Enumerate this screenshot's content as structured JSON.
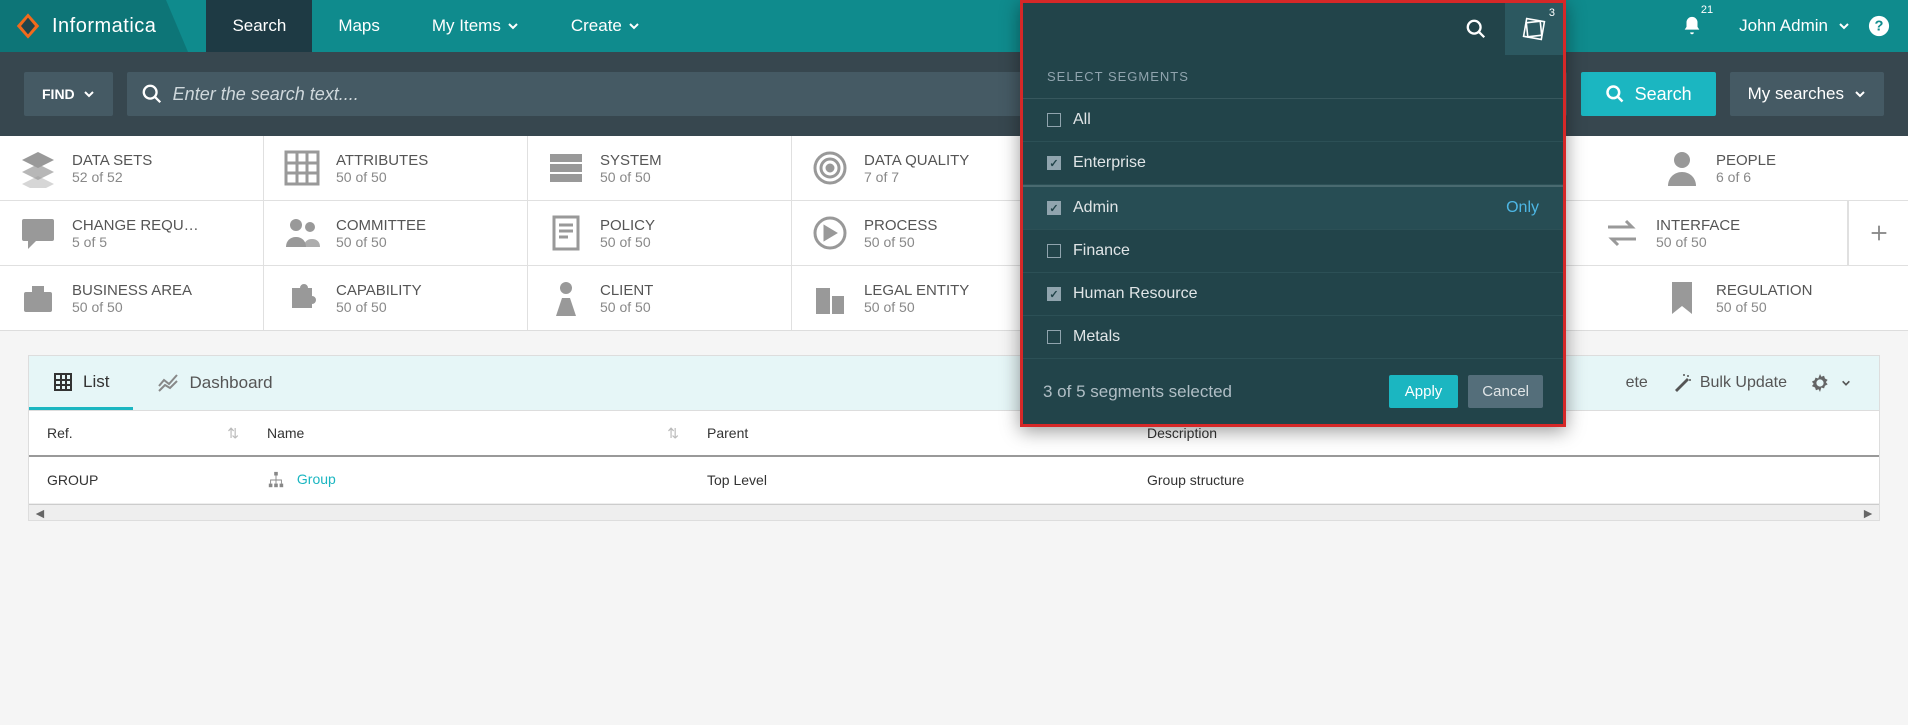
{
  "brand": "Informatica",
  "nav": {
    "items": [
      {
        "label": "Search",
        "active": true
      },
      {
        "label": "Maps"
      },
      {
        "label": "My Items",
        "caret": true
      },
      {
        "label": "Create",
        "caret": true
      }
    ],
    "segments_badge": "3",
    "notify_badge": "21",
    "user": "John Admin"
  },
  "searchbar": {
    "find": "FIND",
    "placeholder": "Enter the search text....",
    "search": "Search",
    "mysearches": "My searches"
  },
  "facets": [
    [
      {
        "title": "DATA SETS",
        "count": "52 of 52"
      },
      {
        "title": "ATTRIBUTES",
        "count": "50 of 50"
      },
      {
        "title": "SYSTEM",
        "count": "50 of 50"
      },
      {
        "title": "DATA QUALITY",
        "count": "7 of 7"
      },
      {
        "title": "",
        "count": ""
      },
      {
        "title": "PEOPLE",
        "count": "6 of 6"
      }
    ],
    [
      {
        "title": "CHANGE REQU…",
        "count": "5 of 5"
      },
      {
        "title": "COMMITTEE",
        "count": "50 of 50"
      },
      {
        "title": "POLICY",
        "count": "50 of 50"
      },
      {
        "title": "PROCESS",
        "count": "50 of 50"
      },
      {
        "title": "",
        "count": ""
      },
      {
        "title": "INTERFACE",
        "count": "50 of 50"
      }
    ],
    [
      {
        "title": "BUSINESS AREA",
        "count": "50 of 50"
      },
      {
        "title": "CAPABILITY",
        "count": "50 of 50"
      },
      {
        "title": "CLIENT",
        "count": "50 of 50"
      },
      {
        "title": "LEGAL ENTITY",
        "count": "50 of 50"
      },
      {
        "title": "",
        "count": ""
      },
      {
        "title": "REGULATION",
        "count": "50 of 50"
      }
    ]
  ],
  "tabs": {
    "list": "List",
    "dashboard": "Dashboard"
  },
  "toolbar": {
    "delete_tail": "ete",
    "bulk": "Bulk Update"
  },
  "table": {
    "headers": {
      "ref": "Ref.",
      "name": "Name",
      "parent": "Parent",
      "description": "Description"
    },
    "rows": [
      {
        "ref": "GROUP",
        "name": "Group",
        "parent": "Top Level",
        "description": "Group structure"
      }
    ]
  },
  "popover": {
    "title": "SELECT SEGMENTS",
    "segments": [
      {
        "label": "All",
        "checked": false
      },
      {
        "label": "Enterprise",
        "checked": true,
        "divider": true
      },
      {
        "label": "Admin",
        "checked": true,
        "only": "Only"
      },
      {
        "label": "Finance",
        "checked": false
      },
      {
        "label": "Human Resource",
        "checked": true
      },
      {
        "label": "Metals",
        "checked": false
      }
    ],
    "status": "3 of 5 segments selected",
    "apply": "Apply",
    "cancel": "Cancel"
  }
}
